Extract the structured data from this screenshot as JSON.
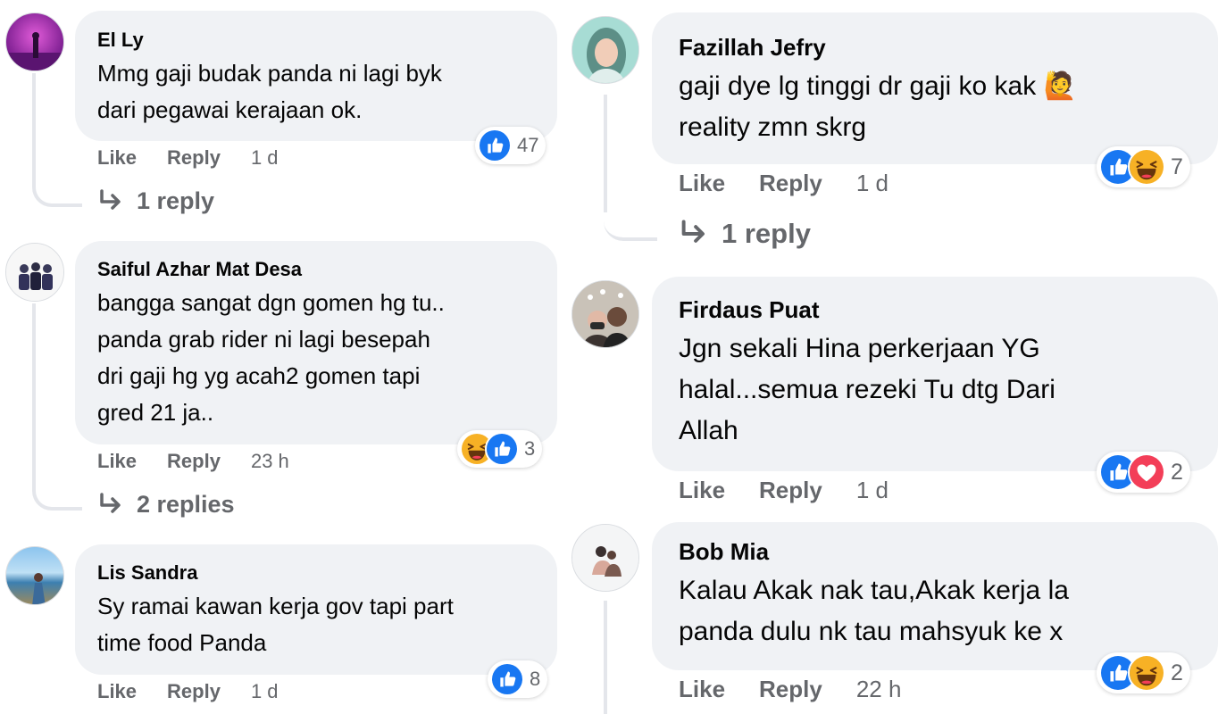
{
  "labels": {
    "like": "Like",
    "reply": "Reply"
  },
  "colors": {
    "bubble_bg": "#f0f2f5",
    "meta_text": "#65676b",
    "like_blue": "#1877f2",
    "love_red": "#f33e58",
    "haha_yellow": "#f7b125"
  },
  "left_comments": [
    {
      "author": "El Ly",
      "text": "Mmg gaji budak panda ni lagi byk\ndari pegawai kerajaan ok.",
      "time": "1 d",
      "reactions": [
        "like-icon"
      ],
      "reaction_count": "47",
      "replies_label": "1 reply"
    },
    {
      "author": "Saiful Azhar Mat Desa",
      "text": "bangga sangat dgn gomen hg tu..\npanda grab rider ni lagi besepah\ndri gaji hg yg acah2 gomen tapi\ngred 21 ja..",
      "time": "23 h",
      "reactions": [
        "haha-icon",
        "like-icon"
      ],
      "reaction_count": "3",
      "replies_label": "2 replies"
    },
    {
      "author": "Lis Sandra",
      "text": "Sy ramai kawan kerja gov tapi part\ntime food Panda",
      "time": "1 d",
      "reactions": [
        "like-icon"
      ],
      "reaction_count": "8"
    }
  ],
  "right_comments": [
    {
      "author": "Fazillah Jefry",
      "text": "gaji dye lg tinggi dr gaji ko kak 🙋\nreality zmn skrg",
      "time": "1 d",
      "reactions": [
        "like-icon",
        "haha-icon"
      ],
      "reaction_count": "7",
      "replies_label": "1 reply"
    },
    {
      "author": "Firdaus Puat",
      "text": "Jgn sekali Hina perkerjaan YG\nhalal...semua rezeki Tu dtg Dari\nAllah",
      "time": "1 d",
      "reactions": [
        "like-icon",
        "love-icon"
      ],
      "reaction_count": "2"
    },
    {
      "author": "Bob Mia",
      "text": "Kalau Akak nak tau,Akak kerja la\npanda dulu nk tau mahsyuk ke x",
      "time": "22 h",
      "reactions": [
        "like-icon",
        "haha-icon"
      ],
      "reaction_count": "2"
    }
  ]
}
